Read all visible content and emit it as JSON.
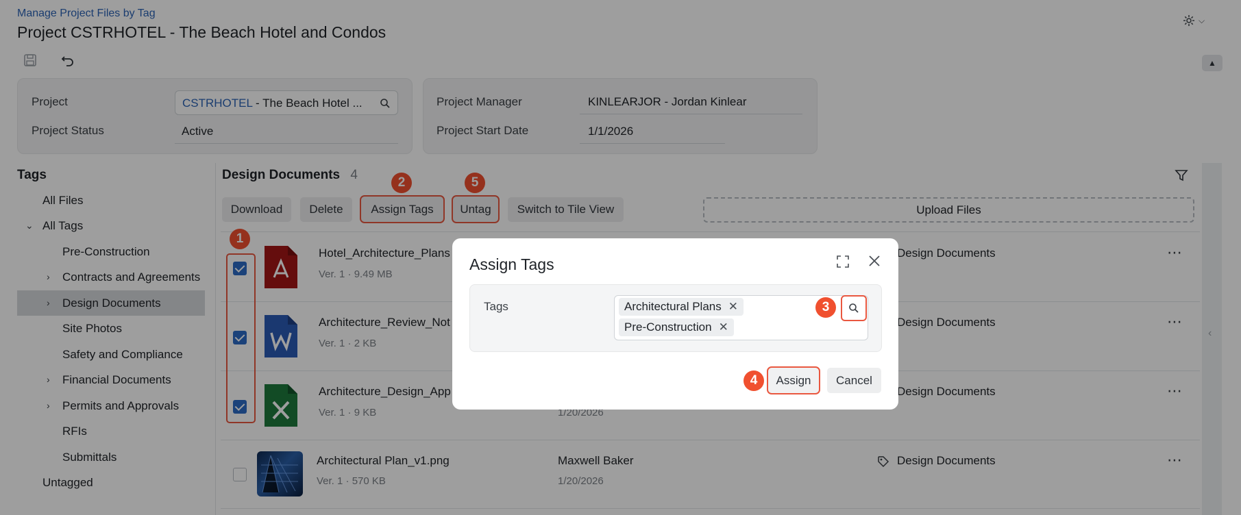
{
  "header": {
    "breadcrumb": "Manage Project Files by Tag",
    "title": "Project CSTRHOTEL - The Beach Hotel and Condos"
  },
  "summary": {
    "project_label": "Project",
    "project_code": "CSTRHOTEL",
    "project_name": " - The Beach Hotel ...",
    "status_label": "Project Status",
    "status_value": "Active",
    "manager_label": "Project Manager",
    "manager_value": "KINLEARJOR - Jordan Kinlear",
    "start_label": "Project Start Date",
    "start_value": "1/1/2026"
  },
  "sidebar": {
    "heading": "Tags",
    "items": [
      {
        "label": "All Files"
      },
      {
        "label": "All Tags"
      },
      {
        "label": "Pre-Construction"
      },
      {
        "label": "Contracts and Agreements"
      },
      {
        "label": "Design Documents"
      },
      {
        "label": "Site Photos"
      },
      {
        "label": "Safety and Compliance"
      },
      {
        "label": "Financial Documents"
      },
      {
        "label": "Permits and Approvals"
      },
      {
        "label": "RFIs"
      },
      {
        "label": "Submittals"
      },
      {
        "label": "Untagged"
      }
    ]
  },
  "main": {
    "section_title": "Design Documents",
    "count": "4",
    "buttons": {
      "download": "Download",
      "delete": "Delete",
      "assign_tags": "Assign Tags",
      "untag": "Untag",
      "tile_view": "Switch to Tile View",
      "upload": "Upload Files"
    }
  },
  "files": [
    {
      "name": "Hotel_Architecture_Plans",
      "version": "Ver. 1",
      "size": "9.49 MB",
      "owner": "",
      "date": "",
      "tag": "Design Documents",
      "type": "pdf",
      "checked": true
    },
    {
      "name": "Architecture_Review_Not",
      "version": "Ver. 1",
      "size": "2 KB",
      "owner": "",
      "date": "",
      "tag": "Design Documents",
      "type": "word",
      "checked": true
    },
    {
      "name": "Architecture_Design_App",
      "version": "Ver. 1",
      "size": "9 KB",
      "owner": "",
      "date": "1/20/2026",
      "tag": "Design Documents",
      "type": "excel",
      "checked": true
    },
    {
      "name": "Architectural Plan_v1.png",
      "version": "Ver. 1",
      "size": "570 KB",
      "owner": "Maxwell Baker",
      "date": "1/20/2026",
      "tag": "Design Documents",
      "type": "image",
      "checked": false
    }
  ],
  "dot": "·",
  "modal": {
    "title": "Assign Tags",
    "tags_label": "Tags",
    "chips": [
      "Architectural Plans",
      "Pre-Construction"
    ],
    "assign": "Assign",
    "cancel": "Cancel"
  },
  "badges": [
    "1",
    "2",
    "3",
    "4",
    "5"
  ],
  "colors": {
    "accent": "#2c63b5",
    "callout": "#f0502f",
    "pdf": "#a31515",
    "word": "#2b5bb5",
    "excel": "#1e7a3c"
  }
}
